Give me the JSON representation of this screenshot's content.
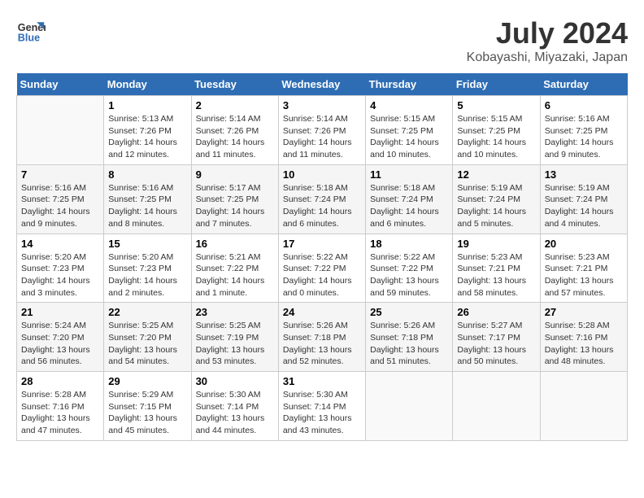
{
  "logo": {
    "line1": "General",
    "line2": "Blue"
  },
  "title": "July 2024",
  "subtitle": "Kobayashi, Miyazaki, Japan",
  "weekdays": [
    "Sunday",
    "Monday",
    "Tuesday",
    "Wednesday",
    "Thursday",
    "Friday",
    "Saturday"
  ],
  "weeks": [
    [
      {
        "day": "",
        "info": ""
      },
      {
        "day": "1",
        "info": "Sunrise: 5:13 AM\nSunset: 7:26 PM\nDaylight: 14 hours\nand 12 minutes."
      },
      {
        "day": "2",
        "info": "Sunrise: 5:14 AM\nSunset: 7:26 PM\nDaylight: 14 hours\nand 11 minutes."
      },
      {
        "day": "3",
        "info": "Sunrise: 5:14 AM\nSunset: 7:26 PM\nDaylight: 14 hours\nand 11 minutes."
      },
      {
        "day": "4",
        "info": "Sunrise: 5:15 AM\nSunset: 7:25 PM\nDaylight: 14 hours\nand 10 minutes."
      },
      {
        "day": "5",
        "info": "Sunrise: 5:15 AM\nSunset: 7:25 PM\nDaylight: 14 hours\nand 10 minutes."
      },
      {
        "day": "6",
        "info": "Sunrise: 5:16 AM\nSunset: 7:25 PM\nDaylight: 14 hours\nand 9 minutes."
      }
    ],
    [
      {
        "day": "7",
        "info": "Sunrise: 5:16 AM\nSunset: 7:25 PM\nDaylight: 14 hours\nand 9 minutes."
      },
      {
        "day": "8",
        "info": "Sunrise: 5:16 AM\nSunset: 7:25 PM\nDaylight: 14 hours\nand 8 minutes."
      },
      {
        "day": "9",
        "info": "Sunrise: 5:17 AM\nSunset: 7:25 PM\nDaylight: 14 hours\nand 7 minutes."
      },
      {
        "day": "10",
        "info": "Sunrise: 5:18 AM\nSunset: 7:24 PM\nDaylight: 14 hours\nand 6 minutes."
      },
      {
        "day": "11",
        "info": "Sunrise: 5:18 AM\nSunset: 7:24 PM\nDaylight: 14 hours\nand 6 minutes."
      },
      {
        "day": "12",
        "info": "Sunrise: 5:19 AM\nSunset: 7:24 PM\nDaylight: 14 hours\nand 5 minutes."
      },
      {
        "day": "13",
        "info": "Sunrise: 5:19 AM\nSunset: 7:24 PM\nDaylight: 14 hours\nand 4 minutes."
      }
    ],
    [
      {
        "day": "14",
        "info": "Sunrise: 5:20 AM\nSunset: 7:23 PM\nDaylight: 14 hours\nand 3 minutes."
      },
      {
        "day": "15",
        "info": "Sunrise: 5:20 AM\nSunset: 7:23 PM\nDaylight: 14 hours\nand 2 minutes."
      },
      {
        "day": "16",
        "info": "Sunrise: 5:21 AM\nSunset: 7:22 PM\nDaylight: 14 hours\nand 1 minute."
      },
      {
        "day": "17",
        "info": "Sunrise: 5:22 AM\nSunset: 7:22 PM\nDaylight: 14 hours\nand 0 minutes."
      },
      {
        "day": "18",
        "info": "Sunrise: 5:22 AM\nSunset: 7:22 PM\nDaylight: 13 hours\nand 59 minutes."
      },
      {
        "day": "19",
        "info": "Sunrise: 5:23 AM\nSunset: 7:21 PM\nDaylight: 13 hours\nand 58 minutes."
      },
      {
        "day": "20",
        "info": "Sunrise: 5:23 AM\nSunset: 7:21 PM\nDaylight: 13 hours\nand 57 minutes."
      }
    ],
    [
      {
        "day": "21",
        "info": "Sunrise: 5:24 AM\nSunset: 7:20 PM\nDaylight: 13 hours\nand 56 minutes."
      },
      {
        "day": "22",
        "info": "Sunrise: 5:25 AM\nSunset: 7:20 PM\nDaylight: 13 hours\nand 54 minutes."
      },
      {
        "day": "23",
        "info": "Sunrise: 5:25 AM\nSunset: 7:19 PM\nDaylight: 13 hours\nand 53 minutes."
      },
      {
        "day": "24",
        "info": "Sunrise: 5:26 AM\nSunset: 7:18 PM\nDaylight: 13 hours\nand 52 minutes."
      },
      {
        "day": "25",
        "info": "Sunrise: 5:26 AM\nSunset: 7:18 PM\nDaylight: 13 hours\nand 51 minutes."
      },
      {
        "day": "26",
        "info": "Sunrise: 5:27 AM\nSunset: 7:17 PM\nDaylight: 13 hours\nand 50 minutes."
      },
      {
        "day": "27",
        "info": "Sunrise: 5:28 AM\nSunset: 7:16 PM\nDaylight: 13 hours\nand 48 minutes."
      }
    ],
    [
      {
        "day": "28",
        "info": "Sunrise: 5:28 AM\nSunset: 7:16 PM\nDaylight: 13 hours\nand 47 minutes."
      },
      {
        "day": "29",
        "info": "Sunrise: 5:29 AM\nSunset: 7:15 PM\nDaylight: 13 hours\nand 45 minutes."
      },
      {
        "day": "30",
        "info": "Sunrise: 5:30 AM\nSunset: 7:14 PM\nDaylight: 13 hours\nand 44 minutes."
      },
      {
        "day": "31",
        "info": "Sunrise: 5:30 AM\nSunset: 7:14 PM\nDaylight: 13 hours\nand 43 minutes."
      },
      {
        "day": "",
        "info": ""
      },
      {
        "day": "",
        "info": ""
      },
      {
        "day": "",
        "info": ""
      }
    ]
  ]
}
